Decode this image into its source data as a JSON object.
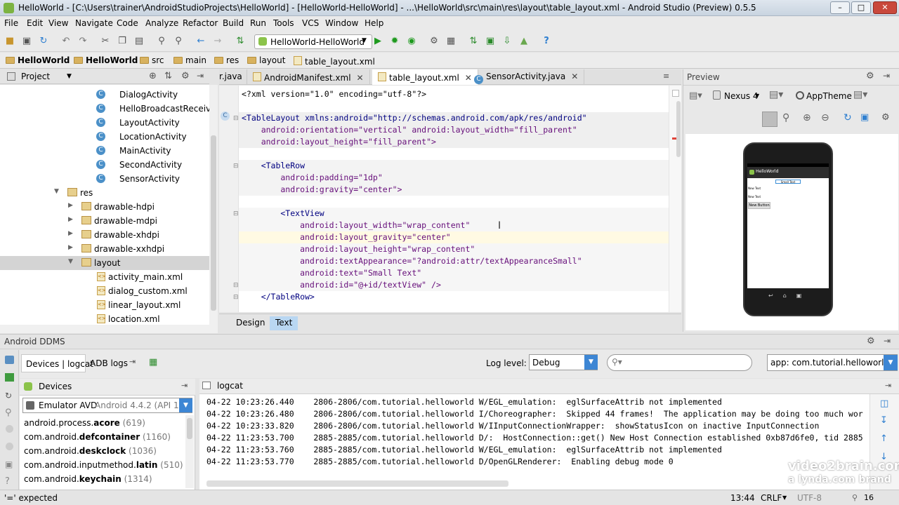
{
  "window": {
    "title": "HelloWorld - [C:\\Users\\trainer\\AndroidStudioProjects\\HelloWorld] - [HelloWorld-HelloWorld] - ...\\HelloWorld\\src\\main\\res\\layout\\table_layout.xml - Android Studio (Preview) 0.5.5"
  },
  "menu": [
    "File",
    "Edit",
    "View",
    "Navigate",
    "Code",
    "Analyze",
    "Refactor",
    "Build",
    "Run",
    "Tools",
    "VCS",
    "Window",
    "Help"
  ],
  "toolbar": {
    "run_config": "HelloWorld-HelloWorld"
  },
  "breadcrumbs": [
    "HelloWorld",
    "HelloWorld",
    "src",
    "main",
    "res",
    "layout",
    "table_layout.xml"
  ],
  "project": {
    "header": "Project",
    "items": [
      {
        "label": "DialogActivity",
        "kind": "class"
      },
      {
        "label": "HelloBroadcastReceiver",
        "kind": "class"
      },
      {
        "label": "LayoutActivity",
        "kind": "class"
      },
      {
        "label": "LocationActivity",
        "kind": "class"
      },
      {
        "label": "MainActivity",
        "kind": "class"
      },
      {
        "label": "SecondActivity",
        "kind": "class"
      },
      {
        "label": "SensorActivity",
        "kind": "class"
      },
      {
        "label": "res",
        "kind": "folder-open"
      },
      {
        "label": "drawable-hdpi",
        "kind": "folder"
      },
      {
        "label": "drawable-mdpi",
        "kind": "folder"
      },
      {
        "label": "drawable-xhdpi",
        "kind": "folder"
      },
      {
        "label": "drawable-xxhdpi",
        "kind": "folder"
      },
      {
        "label": "layout",
        "kind": "folder-open-selected"
      },
      {
        "label": "activity_main.xml",
        "kind": "xml"
      },
      {
        "label": "dialog_custom.xml",
        "kind": "xml"
      },
      {
        "label": "linear_layout.xml",
        "kind": "xml"
      },
      {
        "label": "location.xml",
        "kind": "xml"
      }
    ]
  },
  "tabs": [
    {
      "label": "r.java"
    },
    {
      "label": "AndroidManifest.xml"
    },
    {
      "label": "table_layout.xml"
    },
    {
      "label": "SensorActivity.java"
    }
  ],
  "code": [
    "<?xml version=\"1.0\" encoding=\"utf-8\"?>",
    "",
    "<TableLayout xmlns:android=\"http://schemas.android.com/apk/res/android\"",
    "    android:orientation=\"vertical\" android:layout_width=\"fill_parent\"",
    "    android:layout_height=\"fill_parent\">",
    "",
    "    <TableRow",
    "        android:padding=\"1dp\"",
    "        android:gravity=\"center\">",
    "",
    "        <TextView",
    "            android:layout_width=\"wrap_content\"",
    "            android:layout_gravity=\"center\"",
    "            android:layout_height=\"wrap_content\"",
    "            android:textAppearance=\"?android:attr/textAppearanceSmall\"",
    "            android:text=\"Small Text\"",
    "            android:id=\"@+id/textView\" />",
    "    </TableRow>"
  ],
  "editor_tabs": {
    "design": "Design",
    "text": "Text"
  },
  "preview": {
    "title": "Preview",
    "device": "Nexus 4",
    "theme": "AppTheme",
    "phone_app_title": "HelloWorld",
    "phone_button": "New Button",
    "phone_text1": "New Text",
    "phone_text2": "New Text",
    "phone_small": "Small Text"
  },
  "ddms": {
    "title": "Android DDMS",
    "tab_devices": "Devices | logcat",
    "tab_adb": "ADB logs",
    "log_level_label": "Log level:",
    "log_level": "Debug",
    "search_placeholder": "",
    "app_filter": "app: com.tutorial.helloworld",
    "devices_header": "Devices",
    "logcat_header": "logcat",
    "device": "Emulator AVD",
    "device_detail": "Android 4.4.2 (API 19)",
    "processes": [
      {
        "prefix": "android.process.",
        "bold": "acore",
        "pid": "(619)"
      },
      {
        "prefix": "com.android.",
        "bold": "defcontainer",
        "pid": "(1160)"
      },
      {
        "prefix": "com.android.",
        "bold": "deskclock",
        "pid": "(1036)"
      },
      {
        "prefix": "com.android.inputmethod.",
        "bold": "latin",
        "pid": "(510)"
      },
      {
        "prefix": "com.android.",
        "bold": "keychain",
        "pid": "(1314)"
      }
    ],
    "logs": [
      "04-22 10:23:26.440    2806-2806/com.tutorial.helloworld W/EGL_emulation:  eglSurfaceAttrib not implemented",
      "04-22 10:23:26.480    2806-2806/com.tutorial.helloworld I/Choreographer:  Skipped 44 frames!  The application may be doing too much wor",
      "04-22 10:23:33.820    2806-2806/com.tutorial.helloworld W/IInputConnectionWrapper:  showStatusIcon on inactive InputConnection",
      "04-22 11:23:53.700    2885-2885/com.tutorial.helloworld D/:  HostConnection::get() New Host Connection established 0xb87d6fe0, tid 2885",
      "04-22 11:23:53.760    2885-2885/com.tutorial.helloworld W/EGL_emulation:  eglSurfaceAttrib not implemented",
      "04-22 11:23:53.770    2885-2885/com.tutorial.helloworld D/OpenGLRenderer:  Enabling debug mode 0"
    ]
  },
  "status": {
    "message": "'=' expected",
    "position": "13:44",
    "line_sep": "CRLF",
    "encoding": "UTF-8",
    "counter": "16"
  },
  "watermark": {
    "line1": "video2brain.com",
    "line2": "a lynda.com brand"
  }
}
